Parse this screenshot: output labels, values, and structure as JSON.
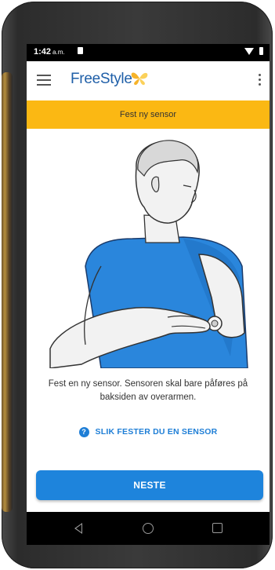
{
  "status_bar": {
    "time": "1:42",
    "ampm": "a.m."
  },
  "app_bar": {
    "brand": "FreeStyle"
  },
  "banner": {
    "title": "Fest ny sensor"
  },
  "instruction": {
    "text": "Fest en ny sensor. Sensoren skal bare påføres på baksiden av overarmen."
  },
  "help": {
    "icon_glyph": "?",
    "link_label": "SLIK FESTER DU EN SENSOR"
  },
  "actions": {
    "next_label": "NESTE"
  },
  "colors": {
    "banner": "#fbb813",
    "brand": "#1f5fa8",
    "accent": "#1e84dc",
    "shirt": "#2a86dc"
  },
  "icons": {
    "menu": "menu-icon",
    "overflow": "more-vert-icon",
    "help": "help-circle-icon",
    "back": "back-icon",
    "home": "home-icon",
    "recent": "recent-apps-icon"
  }
}
